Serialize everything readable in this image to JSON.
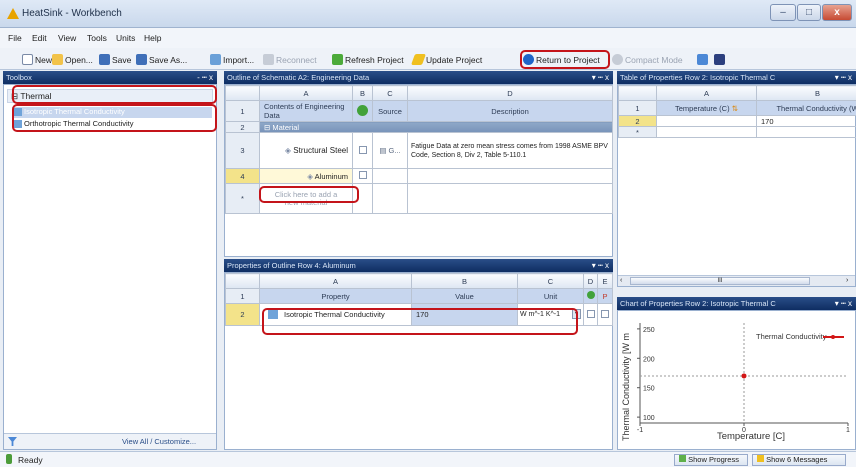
{
  "window": {
    "title": "HeatSink - Workbench",
    "minimize": "–",
    "maximize": "□",
    "close": "x"
  },
  "menu": [
    "File",
    "Edit",
    "View",
    "Tools",
    "Units",
    "Help"
  ],
  "toolbar": {
    "new": "New",
    "open": "Open...",
    "save": "Save",
    "save_as": "Save As...",
    "import": "Import...",
    "reconnect": "Reconnect",
    "refresh": "Refresh Project",
    "update": "Update Project",
    "return": "Return to Project",
    "compact": "Compact Mode"
  },
  "toolbox": {
    "title": "Toolbox",
    "group": "Thermal",
    "items": [
      "Isotropic Thermal Conductivity",
      "Orthotropic Thermal Conductivity"
    ],
    "footer": "View All / Customize..."
  },
  "outline": {
    "title": "Outline of Schematic A2: Engineering Data",
    "columns": [
      "A",
      "B",
      "C",
      "D"
    ],
    "header_row": {
      "num": "1",
      "contents": "Contents of Engineering Data",
      "source": "Source",
      "description": "Description"
    },
    "section": {
      "num": "2",
      "label": "Material"
    },
    "rows": [
      {
        "num": "3",
        "name": "Structural Steel",
        "source": "G...",
        "description": "Fatigue Data at zero mean stress comes from 1998 ASME BPV Code, Section 8, Div 2, Table 5-110.1"
      },
      {
        "num": "4",
        "name": "Aluminum",
        "source": "",
        "description": ""
      },
      {
        "num": "*",
        "name": "Click here to add a new material",
        "source": "",
        "description": ""
      }
    ]
  },
  "properties": {
    "title": "Properties of Outline Row 4: Aluminum",
    "columns": [
      "A",
      "B",
      "C",
      "D",
      "E"
    ],
    "header": {
      "num": "1",
      "property": "Property",
      "value": "Value",
      "unit": "Unit"
    },
    "row": {
      "num": "2",
      "property": "Isotropic Thermal Conductivity",
      "value": "170",
      "unit": "W m^-1 K^-1"
    }
  },
  "table": {
    "title": "Table of Properties Row 2: Isotropic Thermal C",
    "columns": [
      "A",
      "B"
    ],
    "header": {
      "num": "1",
      "temperature": "Temperature (C)",
      "conductivity": "Thermal Conductivity (W"
    },
    "rows": [
      {
        "num": "2",
        "temperature": "",
        "conductivity": "170"
      },
      {
        "num": "*",
        "temperature": "",
        "conductivity": ""
      }
    ],
    "scroll_label": "III"
  },
  "chart": {
    "title": "Chart of Properties Row 2: Isotropic Thermal C",
    "legend": "Thermal Conductivity",
    "xlabel": "Temperature [C]",
    "ylabel": "Thermal Conductivity [W m",
    "yticks": [
      "250",
      "200",
      "150",
      "100"
    ],
    "xticks": [
      "-1",
      "0",
      "1"
    ]
  },
  "chart_data": {
    "type": "scatter",
    "title": "Chart of Properties Row 2: Isotropic Thermal C",
    "xlabel": "Temperature [C]",
    "ylabel": "Thermal Conductivity [W m",
    "xlim": [
      -1,
      1
    ],
    "ylim": [
      90,
      260
    ],
    "series": [
      {
        "name": "Thermal Conductivity",
        "x": [
          0
        ],
        "y": [
          170
        ]
      }
    ],
    "legend": "top-right",
    "grid": false
  },
  "status": {
    "ready": "Ready",
    "show_progress": "Show Progress",
    "show_messages": "Show 6 Messages"
  },
  "colors": {
    "highlight_red": "#c4141a",
    "panel_header": "#1a3a72",
    "series": "#d21616",
    "selection": "#c7d6ee"
  }
}
